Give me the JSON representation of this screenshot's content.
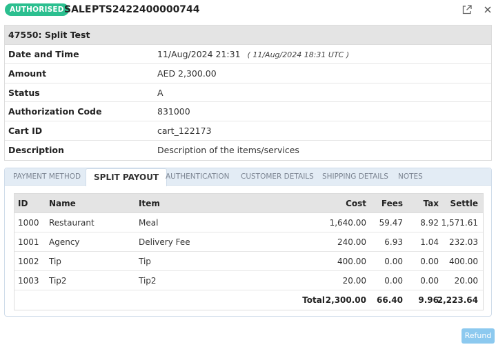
{
  "header": {
    "status_badge": "AUTHORISED",
    "type": "SALE",
    "reference": "PTS2422400000744",
    "icons": {
      "open": "external-link-icon",
      "close": "close-icon"
    },
    "badge_color": "#2bbf8f"
  },
  "details": {
    "title": "47550: Split Test",
    "rows": [
      {
        "label": "Date and Time",
        "value": "11/Aug/2024 21:31",
        "extra": "( 11/Aug/2024 18:31 UTC )"
      },
      {
        "label": "Amount",
        "value": "AED 2,300.00"
      },
      {
        "label": "Status",
        "value": "A"
      },
      {
        "label": "Authorization Code",
        "value": "831000"
      },
      {
        "label": "Cart ID",
        "value": "cart_122173"
      },
      {
        "label": "Description",
        "value": "Description of the items/services"
      }
    ]
  },
  "tabs": [
    {
      "label": "PAYMENT METHOD",
      "active": false
    },
    {
      "label": "SPLIT PAYOUT",
      "active": true
    },
    {
      "label": "AUTHENTICATION",
      "active": false
    },
    {
      "label": "CUSTOMER DETAILS",
      "active": false
    },
    {
      "label": "SHIPPING DETAILS",
      "active": false
    },
    {
      "label": "NOTES",
      "active": false
    }
  ],
  "split": {
    "headers": {
      "id": "ID",
      "name": "Name",
      "item": "Item",
      "cost": "Cost",
      "fees": "Fees",
      "tax": "Tax",
      "settle": "Settle"
    },
    "rows": [
      {
        "id": "1000",
        "name": "Restaurant",
        "item": "Meal",
        "cost": "1,640.00",
        "fees": "59.47",
        "tax": "8.92",
        "settle": "1,571.61"
      },
      {
        "id": "1001",
        "name": "Agency",
        "item": "Delivery Fee",
        "cost": "240.00",
        "fees": "6.93",
        "tax": "1.04",
        "settle": "232.03"
      },
      {
        "id": "1002",
        "name": "Tip",
        "item": "Tip",
        "cost": "400.00",
        "fees": "0.00",
        "tax": "0.00",
        "settle": "400.00"
      },
      {
        "id": "1003",
        "name": "Tip2",
        "item": "Tip2",
        "cost": "20.00",
        "fees": "0.00",
        "tax": "0.00",
        "settle": "20.00"
      }
    ],
    "total": {
      "label": "Total",
      "cost": "2,300.00",
      "fees": "66.40",
      "tax": "9.96",
      "settle": "2,223.64"
    }
  },
  "actions": {
    "refund_label": "Refund",
    "refund_color": "#8cc9ef"
  }
}
